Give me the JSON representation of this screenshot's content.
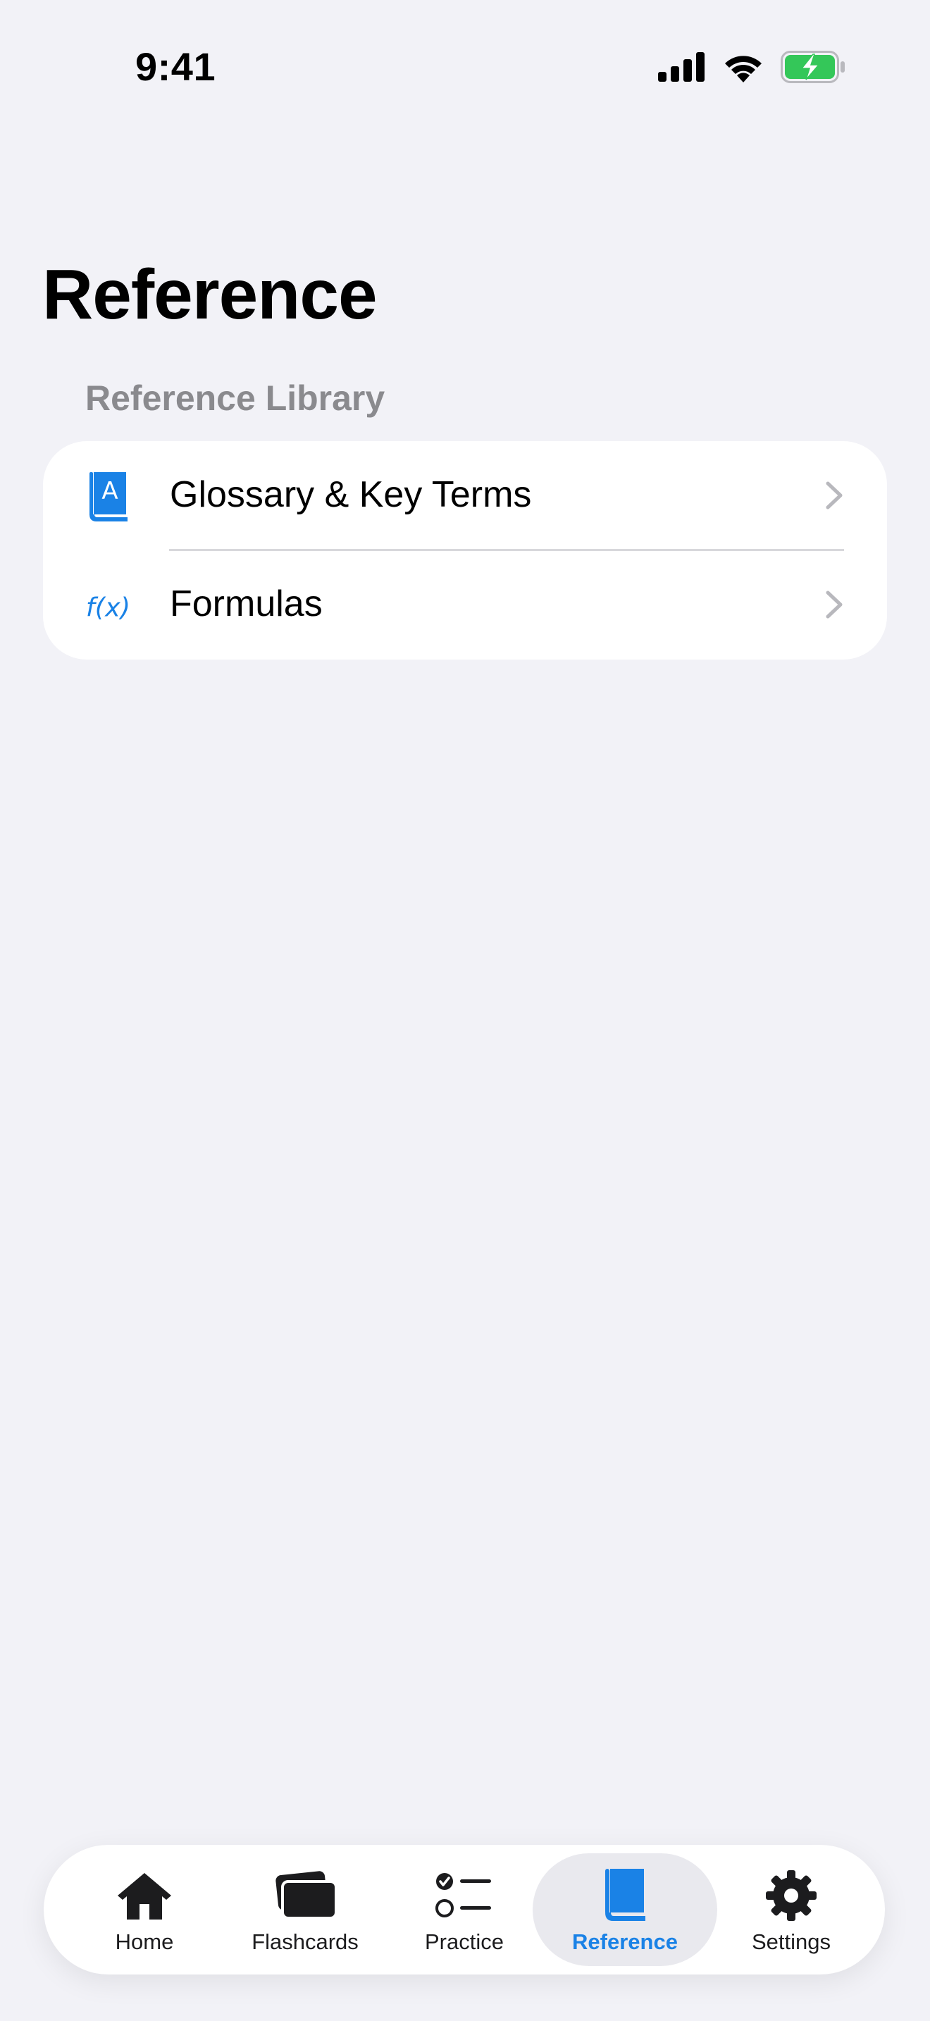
{
  "status_bar": {
    "time": "9:41",
    "icons": [
      "cellular-signal-icon",
      "wifi-icon",
      "battery-charging-icon"
    ]
  },
  "header": {
    "title": "Reference"
  },
  "library": {
    "section_title": "Reference Library",
    "items": [
      {
        "label": "Glossary & Key Terms",
        "icon": "book-letter-a-icon"
      },
      {
        "label": "Formulas",
        "icon": "function-icon",
        "icon_text": "f(x)"
      }
    ]
  },
  "tab_bar": {
    "selected": "Reference",
    "items": [
      {
        "label": "Home",
        "icon": "house-icon"
      },
      {
        "label": "Flashcards",
        "icon": "cards-icon"
      },
      {
        "label": "Practice",
        "icon": "checklist-icon"
      },
      {
        "label": "Reference",
        "icon": "book-icon"
      },
      {
        "label": "Settings",
        "icon": "gear-icon"
      }
    ]
  },
  "colors": {
    "accent": "#1a82e6",
    "background": "#f2f2f7",
    "card": "#ffffff",
    "battery": "#34c759",
    "secondary_text": "#8a8a8e"
  }
}
